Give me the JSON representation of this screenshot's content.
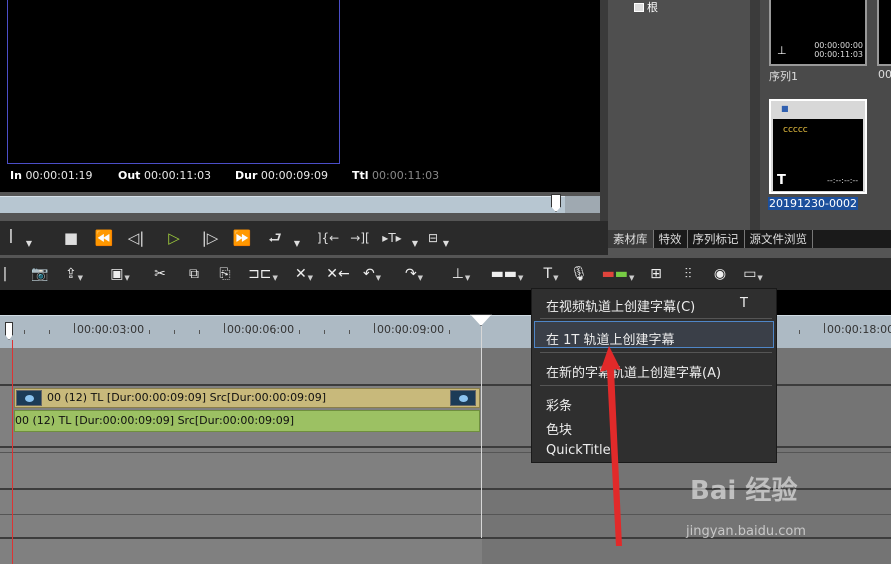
{
  "player": {
    "in_label": "In",
    "in_value": "00:00:01:19",
    "out_label": "Out",
    "out_value": "00:00:11:03",
    "dur_label": "Dur",
    "dur_value": "00:00:09:09",
    "ttl_label": "Ttl",
    "ttl_value": "00:00:11:03"
  },
  "bin": {
    "root_label": "根"
  },
  "assets": [
    {
      "name": "序列1",
      "tc1": "00:00:00:00",
      "tc2": "00:00:11:03"
    },
    {
      "name": "20191230-0002",
      "thumb_text": "ccccc",
      "thumb_t": "T",
      "thumb_tc": "--:--:--:--",
      "selected": true
    },
    {
      "name": "00"
    }
  ],
  "tabs": [
    "素材库",
    "特效",
    "序列标记",
    "源文件浏览"
  ],
  "ruler": {
    "labels": [
      "00:00:03:00",
      "00:00:06:00",
      "00:00:09:00",
      "00:00:18:00"
    ]
  },
  "clips": {
    "video_label": "00 (12)  TL [Dur:00:00:09:09]  Src[Dur:00:00:09:09]",
    "audio_label": "00 (12)  TL [Dur:00:00:09:09]  Src[Dur:00:00:09:09]"
  },
  "context_menu": {
    "items": [
      {
        "label": "在视频轨道上创建字幕(C)",
        "shortcut": "T"
      },
      {
        "label": "在 1T 轨道上创建字幕",
        "highlighted": true
      },
      {
        "label": "在新的字幕轨道上创建字幕(A)"
      },
      {
        "label": "彩条"
      },
      {
        "label": "色块"
      },
      {
        "label": "QuickTitler"
      }
    ]
  },
  "watermark": {
    "brand": "Bai 经验",
    "url": "jingyan.baidu.com"
  },
  "colors": {
    "video_clip": "#c8b97b",
    "audio_clip": "#9cc163",
    "menu_highlight": "#4f86c7",
    "play": "#9ecb3c",
    "selected_caption": "#1c4f9c"
  }
}
